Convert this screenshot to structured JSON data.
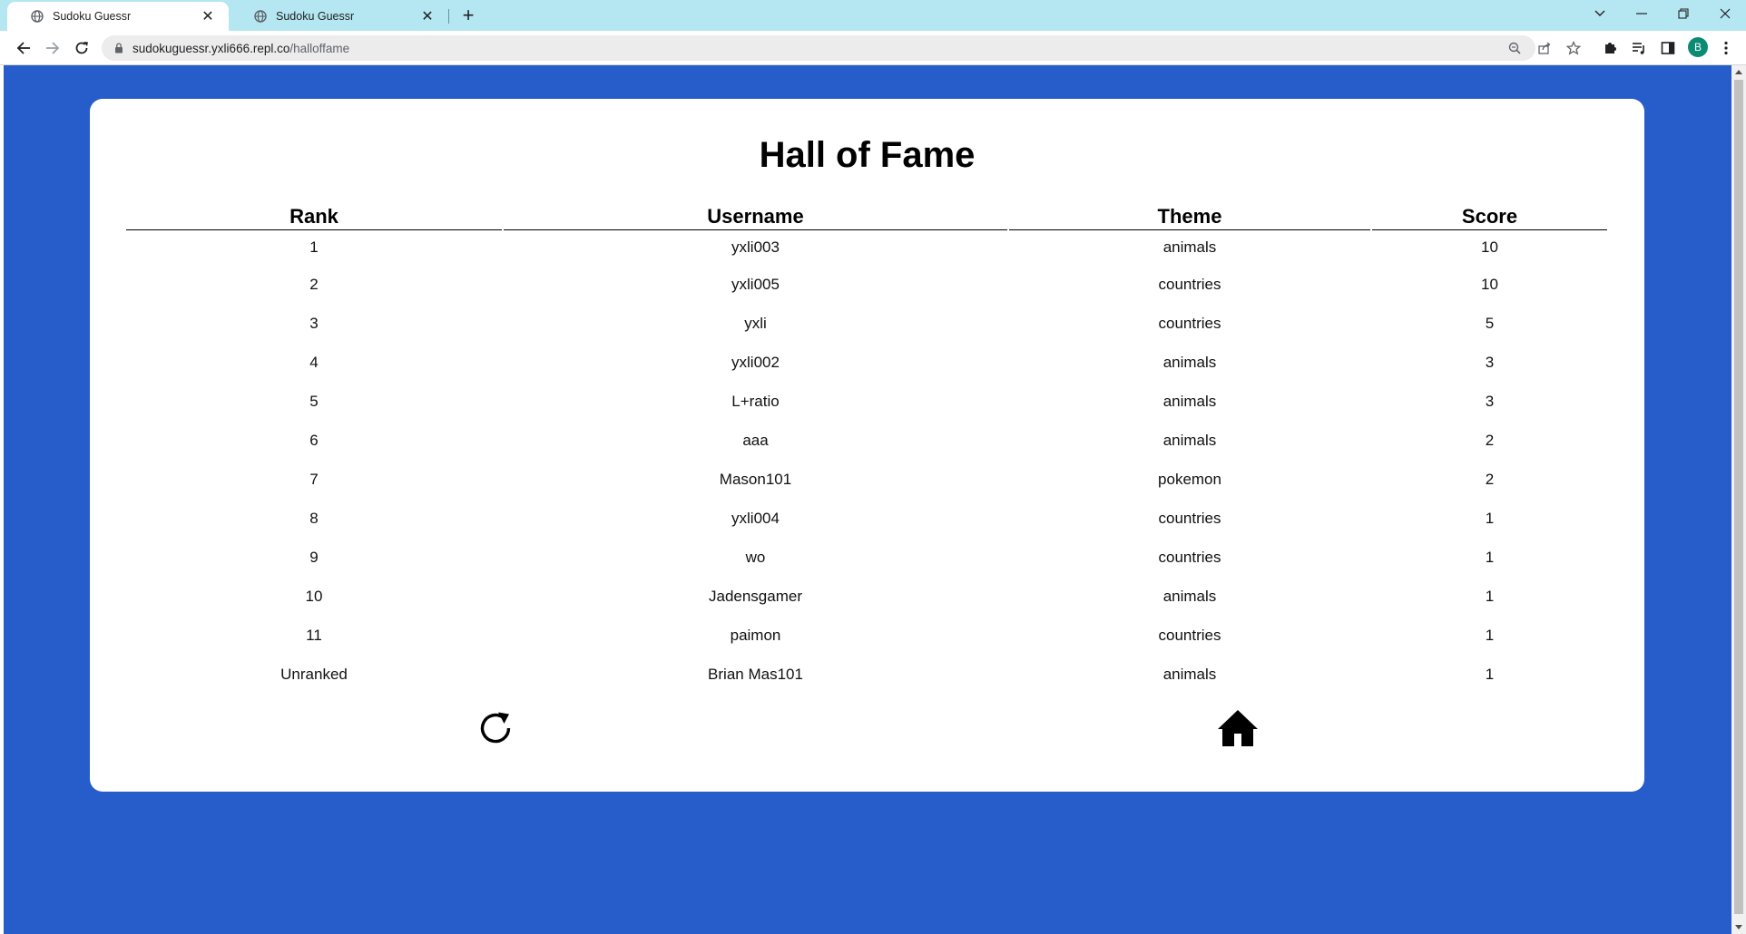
{
  "browser": {
    "tabs": [
      {
        "title": "Sudoku Guessr",
        "active": true
      },
      {
        "title": "Sudoku Guessr",
        "active": false
      }
    ],
    "url_host": "sudokuguessr.yxli666.repl.co",
    "url_path": "/halloffame",
    "profile_initial": "B",
    "accent": "#0b8b73"
  },
  "page": {
    "background": "#265dcb",
    "title": "Hall of Fame",
    "columns": [
      "Rank",
      "Username",
      "Theme",
      "Score"
    ],
    "rows": [
      {
        "rank": "1",
        "username": "yxli003",
        "theme": "animals",
        "score": "10"
      },
      {
        "rank": "2",
        "username": "yxli005",
        "theme": "countries",
        "score": "10"
      },
      {
        "rank": "3",
        "username": "yxli",
        "theme": "countries",
        "score": "5"
      },
      {
        "rank": "4",
        "username": "yxli002",
        "theme": "animals",
        "score": "3"
      },
      {
        "rank": "5",
        "username": "L+ratio",
        "theme": "animals",
        "score": "3"
      },
      {
        "rank": "6",
        "username": "aaa",
        "theme": "animals",
        "score": "2"
      },
      {
        "rank": "7",
        "username": "Mason101",
        "theme": "pokemon",
        "score": "2"
      },
      {
        "rank": "8",
        "username": "yxli004",
        "theme": "countries",
        "score": "1"
      },
      {
        "rank": "9",
        "username": "wo",
        "theme": "countries",
        "score": "1"
      },
      {
        "rank": "10",
        "username": "Jadensgamer",
        "theme": "animals",
        "score": "1"
      },
      {
        "rank": "11",
        "username": "paimon",
        "theme": "countries",
        "score": "1"
      },
      {
        "rank": "Unranked",
        "username": "Brian Mas101",
        "theme": "animals",
        "score": "1"
      }
    ],
    "actions": [
      {
        "icon": "refresh-icon"
      },
      {
        "icon": "home-icon"
      }
    ]
  }
}
